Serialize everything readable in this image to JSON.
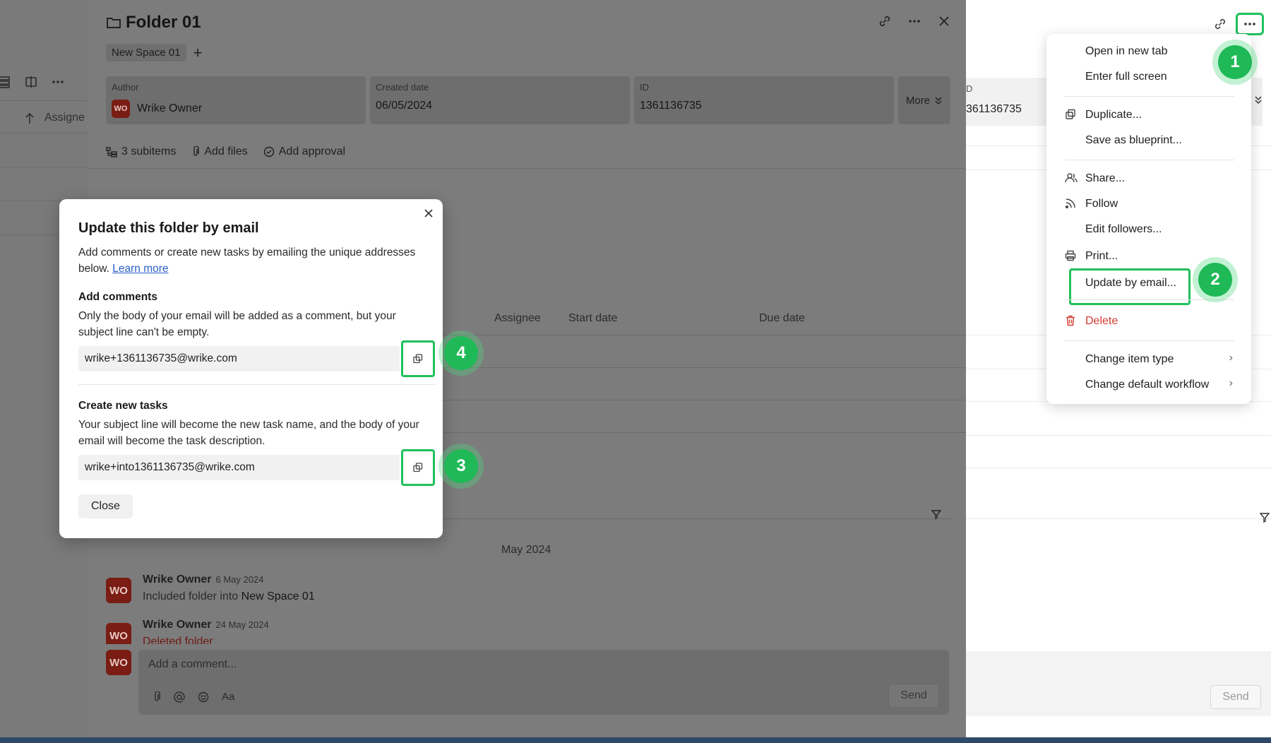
{
  "background": {
    "assignee_col_label": "Assigne"
  },
  "folder_panel": {
    "title": "Folder 01",
    "breadcrumb": "New Space 01",
    "author_label": "Author",
    "author_initials": "WO",
    "author_name": "Wrike Owner",
    "created_label": "Created date",
    "created_value": "06/05/2024",
    "id_label": "ID",
    "id_value": "1361136735",
    "more_label": "More",
    "subitems": "3 subitems",
    "add_files": "Add files",
    "add_approval": "Add approval",
    "table_headers": {
      "assignee": "Assignee",
      "start": "Start date",
      "due": "Due date"
    },
    "month": "May 2024",
    "activity": [
      {
        "initials": "WO",
        "name": "Wrike Owner",
        "date": "6 May 2024",
        "prefix": "Included folder into ",
        "target": "New Space 01"
      },
      {
        "initials": "WO",
        "name": "Wrike Owner",
        "date": "24 May 2024",
        "prefix": "Deleted folder",
        "target": ""
      }
    ],
    "comment_initials": "WO",
    "comment_placeholder": "Add a comment...",
    "format_label": "Aa",
    "send_label": "Send"
  },
  "right_panel": {
    "id_label": "D",
    "id_value": "361136735",
    "send_label": "Send"
  },
  "context_menu": {
    "items": [
      {
        "label": "Open in new tab"
      },
      {
        "label": "Enter full screen"
      },
      {
        "label": "Duplicate...",
        "icon": "duplicate-icon"
      },
      {
        "label": "Save as blueprint..."
      },
      {
        "label": "Share...",
        "icon": "share-icon"
      },
      {
        "label": "Follow",
        "icon": "follow-icon"
      },
      {
        "label": "Edit followers..."
      },
      {
        "label": "Print...",
        "icon": "print-icon"
      },
      {
        "label": "Update by email..."
      },
      {
        "label": "Delete",
        "icon": "trash-icon"
      },
      {
        "label": "Change item type"
      },
      {
        "label": "Change default workflow"
      }
    ]
  },
  "dialog": {
    "title": "Update this folder by email",
    "intro": "Add comments or create new tasks by emailing the unique addresses below.",
    "learn_more": "Learn more",
    "comments_heading": "Add comments",
    "comments_desc": "Only the body of your email will be added as a comment, but your subject line can't be empty.",
    "comments_address": "wrike+1361136735@wrike.com",
    "tasks_heading": "Create new tasks",
    "tasks_desc": "Your subject line will become the new task name, and the body of your email will become the task description.",
    "tasks_address": "wrike+into1361136735@wrike.com",
    "close_label": "Close"
  },
  "steps": [
    "1",
    "2",
    "3",
    "4"
  ],
  "colors": {
    "accent_green": "#1fb957",
    "danger_red": "#d23b31",
    "link_blue": "#2b61c9",
    "avatar_red": "#b5362a"
  }
}
